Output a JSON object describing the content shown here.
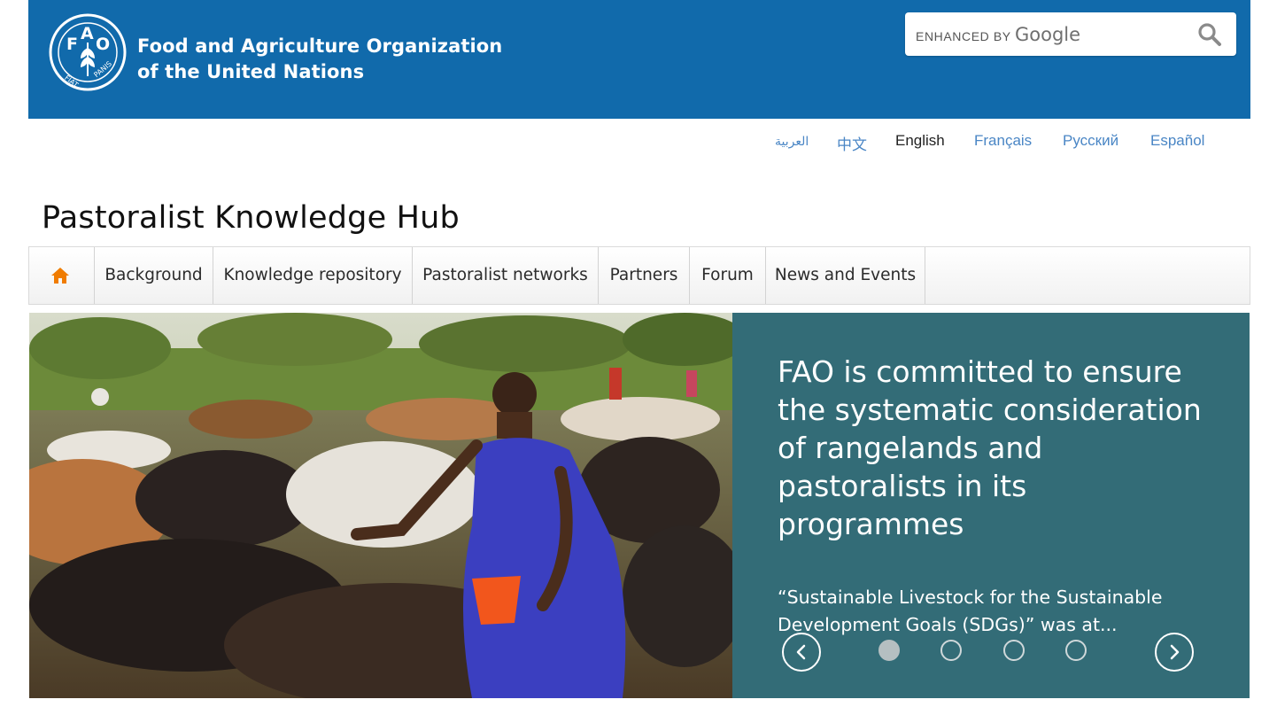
{
  "header": {
    "org_name_line1": "Food and Agriculture Organization",
    "org_name_line2": "of the United Nations",
    "logo_text_fao": "FAO",
    "logo_text_motto": "FIAT PANIS",
    "background_color": "#116aab"
  },
  "search": {
    "enhanced_by": "ENHANCED BY",
    "brand": "Google",
    "value": "",
    "icon": "search-icon"
  },
  "languages": [
    {
      "label": "العربية",
      "active": false
    },
    {
      "label": "中文",
      "active": false
    },
    {
      "label": "English",
      "active": true
    },
    {
      "label": "Français",
      "active": false
    },
    {
      "label": "Русский",
      "active": false
    },
    {
      "label": "Español",
      "active": false
    }
  ],
  "page_title": "Pastoralist Knowledge Hub",
  "nav": {
    "home_icon": "home-icon",
    "home_icon_color": "#f07c00",
    "items": [
      {
        "label": "Background"
      },
      {
        "label": "Knowledge repository"
      },
      {
        "label": "Pastoralist networks"
      },
      {
        "label": "Partners"
      },
      {
        "label": "Forum"
      },
      {
        "label": "News and Events"
      }
    ]
  },
  "hero": {
    "heading": "FAO is committed to ensure the systematic consideration of rangelands and pastoralists in its programmes",
    "text": "“Sustainable Livestock for the Sustainable Development Goals (SDGs)” was at...",
    "panel_color": "#336c77",
    "prev_icon": "chevron-left-icon",
    "next_icon": "chevron-right-icon",
    "slides": 4,
    "active_slide": 1
  }
}
